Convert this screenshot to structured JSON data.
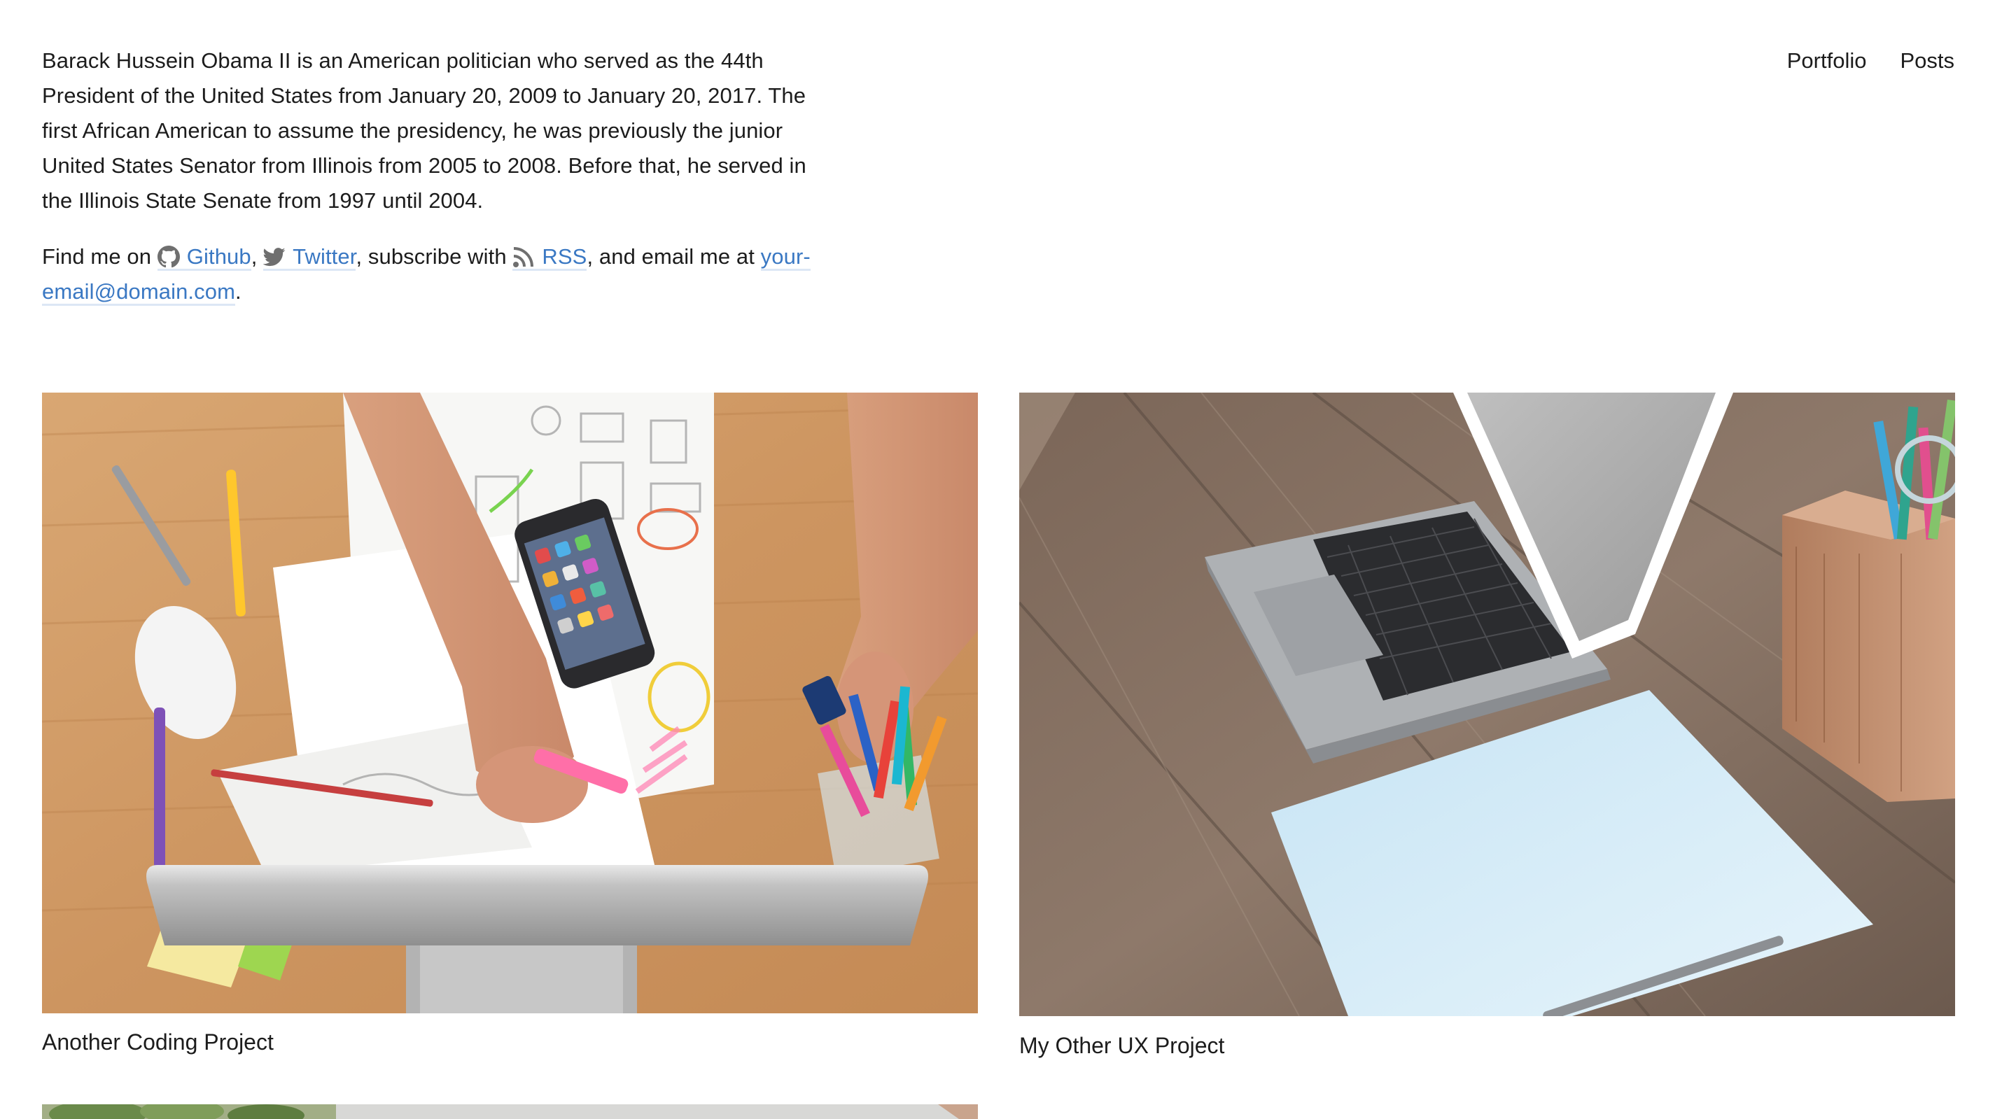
{
  "bio": {
    "paragraph": "Barack Hussein Obama II is an American politician who served as the 44th President of the United States from January 20, 2009 to January 20, 2017. The first African American to assume the presidency, he was previously the junior United States Senator from Illinois from 2005 to 2008. Before that, he served in the Illinois State Senate from 1997 until 2004.",
    "find_prefix": "Find me on",
    "github_label": "Github",
    "twitter_label": "Twitter",
    "subscribe_text": ", subscribe with",
    "rss_label": "RSS",
    "email_prefix": ", and email me at",
    "email": "your-email@domain.com",
    "link_color": "#3a78c3"
  },
  "nav": {
    "items": [
      {
        "label": "Portfolio"
      },
      {
        "label": "Posts"
      }
    ]
  },
  "projects": [
    {
      "title": "Another Coding Project",
      "image": "desk-top-down-coding-photo"
    },
    {
      "title": "My Other UX Project",
      "image": "laptop-on-wooden-desk-photo"
    },
    {
      "title": "",
      "image": "plant-photo-partial"
    }
  ]
}
